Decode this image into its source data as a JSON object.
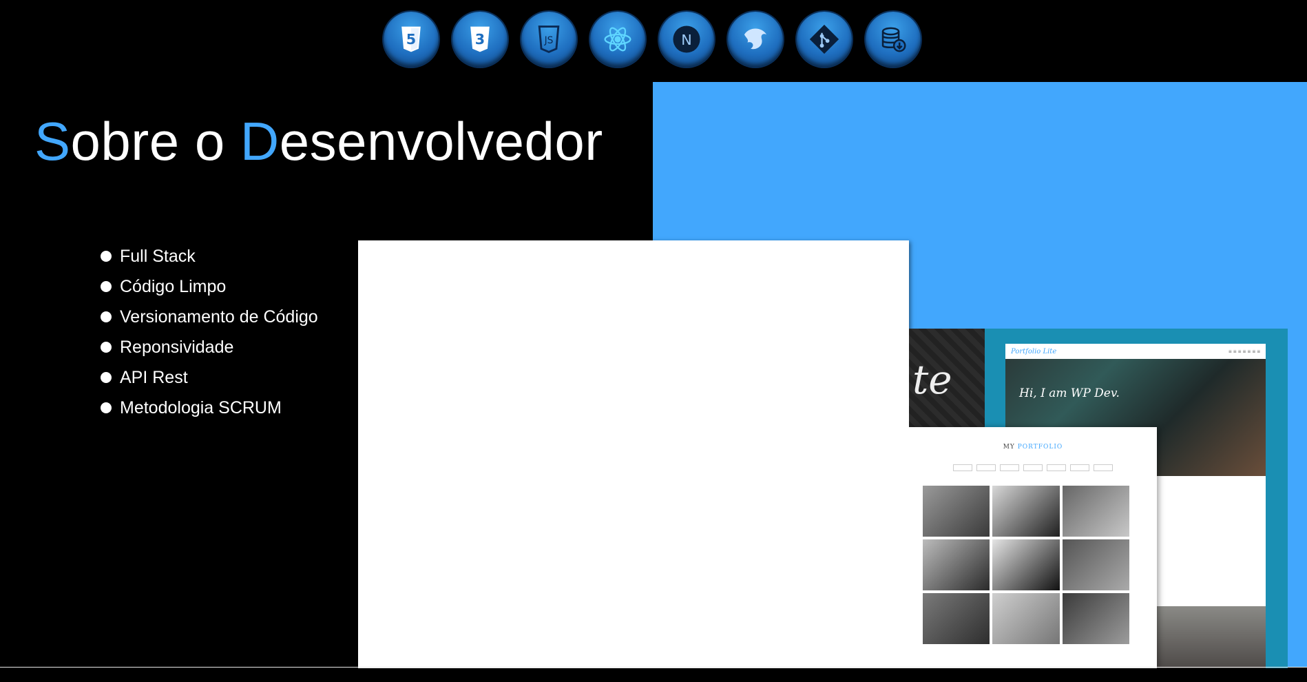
{
  "tech_icons": [
    {
      "name": "html5-icon",
      "glyph": "5"
    },
    {
      "name": "css3-icon",
      "glyph": "3"
    },
    {
      "name": "javascript-icon",
      "glyph": "JS"
    },
    {
      "name": "react-icon"
    },
    {
      "name": "nextjs-icon",
      "glyph": "N"
    },
    {
      "name": "nestjs-icon"
    },
    {
      "name": "git-icon"
    },
    {
      "name": "database-icon"
    }
  ],
  "about": {
    "title_first_initial": "S",
    "title_first_rest": "obre o ",
    "title_second_initial": "D",
    "title_second_rest": "esenvolvedor"
  },
  "features": [
    "Full Stack",
    "Código Limpo",
    "Versionamento de Código",
    "Reponsividade",
    "API Rest",
    "Metodologia SCRUM"
  ],
  "mockup": {
    "script_text": "te",
    "nav_logo": "Portfolio Lite",
    "hero_text": "Hi, I am WP Dev.",
    "portfolio_title_a": "MY ",
    "portfolio_title_b": "PORTFOLIO"
  },
  "colors": {
    "accent": "#42a7fd",
    "background": "#000000",
    "icon_blue": "#1f6fc0"
  }
}
